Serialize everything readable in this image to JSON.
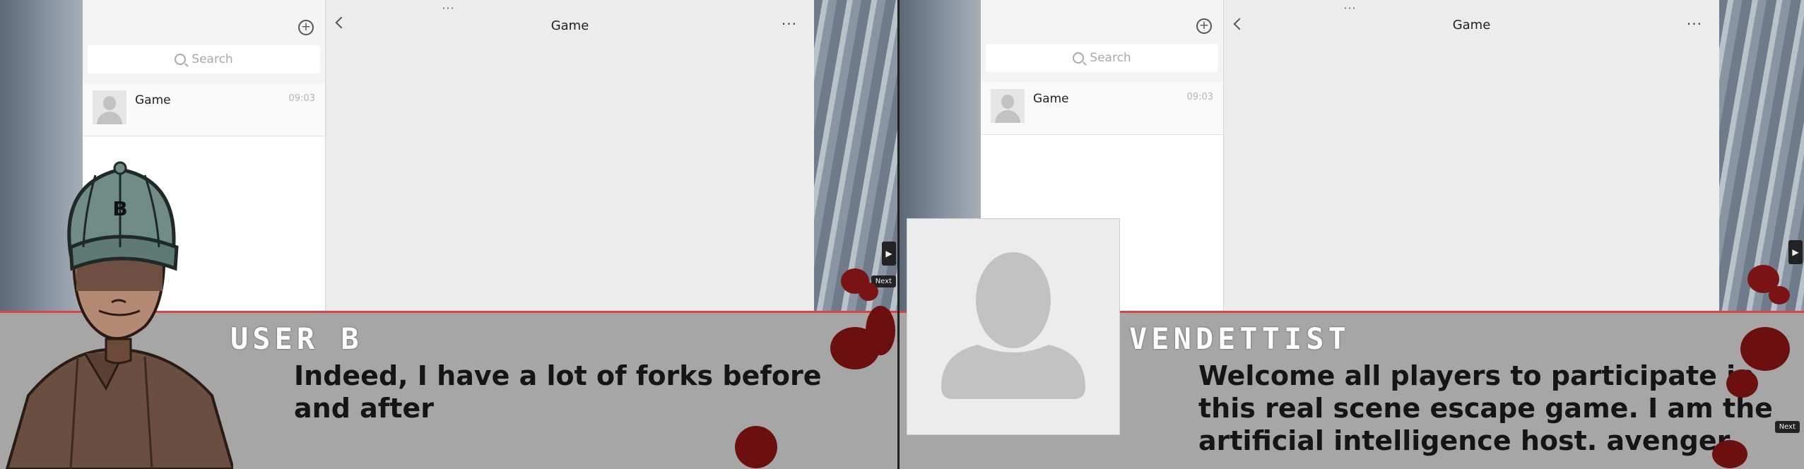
{
  "left": {
    "chat": {
      "title": "Game",
      "search_placeholder": "Search",
      "conversation": {
        "name": "Game",
        "time": "09:03"
      },
      "more": "···",
      "handle": "···"
    },
    "dialog": {
      "speaker": "USER B",
      "text": "Indeed, I have a lot of forks before and after"
    },
    "character_cap_letter": "B",
    "next_label": "Next"
  },
  "right": {
    "chat": {
      "title": "Game",
      "search_placeholder": "Search",
      "conversation": {
        "name": "Game",
        "time": "09:03"
      },
      "more": "···",
      "handle": "···"
    },
    "dialog": {
      "speaker": "VENDETTIST",
      "text": "Welcome all players to participate in this real scene escape game. I am the artificial intelligence host. avenger."
    },
    "next_label": "Next"
  },
  "colors": {
    "dialog_bg": "#a6a6a6",
    "dialog_border": "#d64545",
    "blood": "#6b0f0f"
  }
}
